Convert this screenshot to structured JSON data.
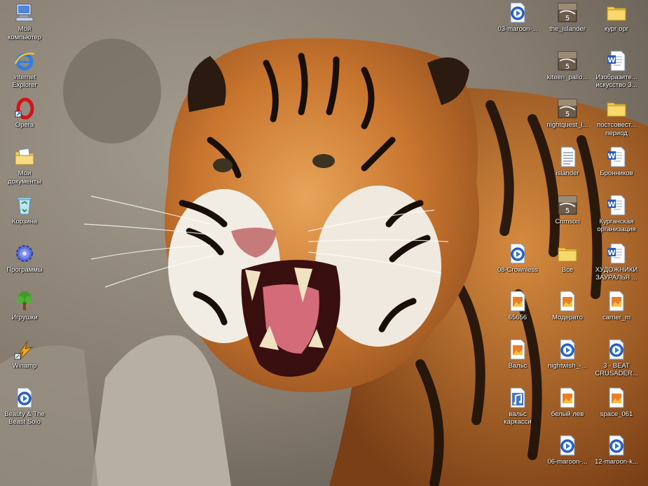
{
  "desktop": {
    "left_icons": [
      {
        "label": "Мой\nкомпьютер",
        "icon": "my-computer-icon"
      },
      {
        "label": "Internet\nExplorer",
        "icon": "internet-explorer-icon"
      },
      {
        "label": "Opera",
        "icon": "opera-icon"
      },
      {
        "label": "Мои\nдокументы",
        "icon": "my-documents-icon"
      },
      {
        "label": "Корзина",
        "icon": "recycle-bin-icon"
      },
      {
        "label": "Программы",
        "icon": "programs-gear-icon"
      },
      {
        "label": "Игрушки",
        "icon": "games-tree-icon"
      },
      {
        "label": "Winamp",
        "icon": "winamp-icon"
      },
      {
        "label": "Beauty & The\nBeast Solo",
        "icon": "media-file-icon"
      }
    ],
    "right_icons": [
      {
        "label": "03-maroon-...",
        "icon": "media-file-icon"
      },
      {
        "label": "the_islander",
        "icon": "media-clip-icon"
      },
      {
        "label": "кург орг",
        "icon": "folder-icon"
      },
      {
        "label": "kiteen_pallo...",
        "icon": "media-clip-icon"
      },
      {
        "label": "Изобразите...\nискусство З...",
        "icon": "word-doc-icon"
      },
      {
        "label": "nightquest_l...",
        "icon": "media-clip-icon"
      },
      {
        "label": "постсовест...\nпериод",
        "icon": "folder-icon"
      },
      {
        "label": "islander",
        "icon": "text-doc-icon"
      },
      {
        "label": "Бронников",
        "icon": "word-doc-icon"
      },
      {
        "label": "Crimson",
        "icon": "media-clip-icon"
      },
      {
        "label": "Курганская\nорганизация",
        "icon": "word-doc-icon"
      },
      {
        "label": "08-Crownless",
        "icon": "media-file-icon"
      },
      {
        "label": "Все",
        "icon": "folder-icon"
      },
      {
        "label": "ХУДОЖНИКИ\nЗАУРАЛЬЯ ...",
        "icon": "word-doc-icon"
      },
      {
        "label": "65656",
        "icon": "image-file-icon"
      },
      {
        "label": "Модерато",
        "icon": "image-file-icon"
      },
      {
        "label": "carrier_m",
        "icon": "image-file-icon"
      },
      {
        "label": "Вальс",
        "icon": "image-file-icon"
      },
      {
        "label": "nightwish_-...",
        "icon": "media-file-icon"
      },
      {
        "label": "3 - BEAT\nCRUSADER...",
        "icon": "media-file-icon"
      },
      {
        "label": "вальс\nкаркасси",
        "icon": "audio-file-icon"
      },
      {
        "label": "белый лев",
        "icon": "image-file-icon"
      },
      {
        "label": "space_061",
        "icon": "image-file-icon"
      },
      {
        "label": "06-maroon-...",
        "icon": "media-file-icon"
      },
      {
        "label": "12-maroon-k...",
        "icon": "media-file-icon"
      }
    ]
  }
}
